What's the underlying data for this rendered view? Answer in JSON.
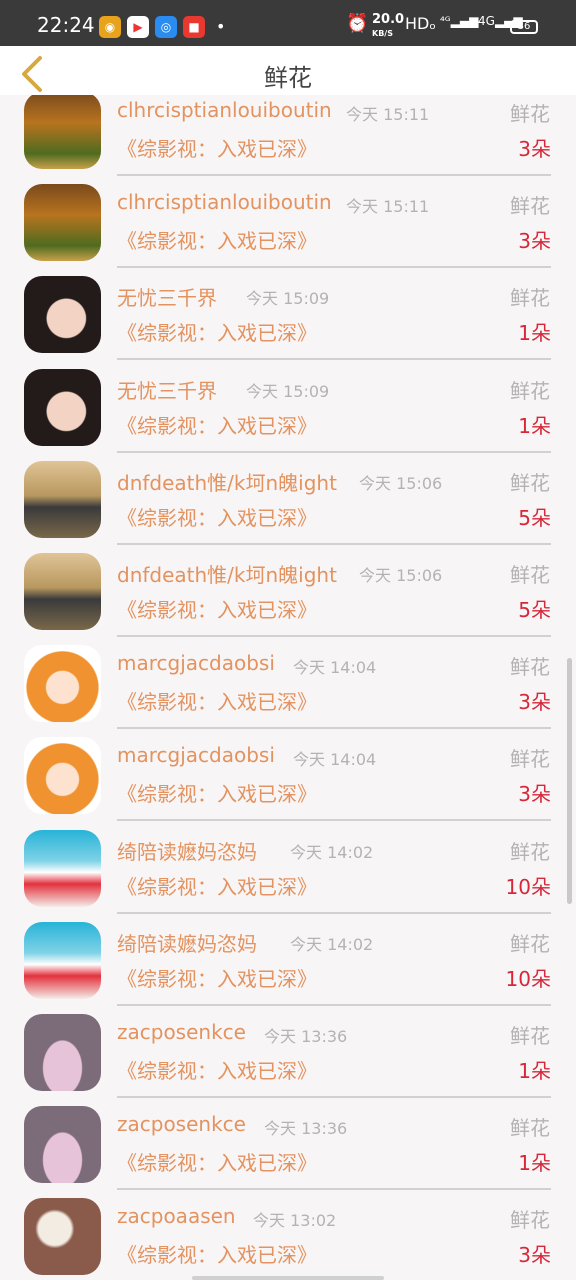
{
  "status_bar": {
    "time": "22:24",
    "speed": "20.0",
    "speed_unit": "KB/S",
    "hd": "HDₒ",
    "net1": "⁴ᴳ",
    "net2": "4G",
    "battery": "36",
    "dot": "•"
  },
  "header": {
    "title": "鲜花",
    "back_icon": "chevron-left-icon"
  },
  "items": [
    {
      "name": "clhrcisptianlouiboutin",
      "time": "今天 15:11",
      "gift": "鲜花",
      "work": "《综影视：入戏已深》",
      "count": "3朵"
    },
    {
      "name": "clhrcisptianlouiboutin",
      "time": "今天 15:11",
      "gift": "鲜花",
      "work": "《综影视：入戏已深》",
      "count": "3朵"
    },
    {
      "name": "无忧三千界",
      "time": "今天 15:09",
      "gift": "鲜花",
      "work": "《综影视：入戏已深》",
      "count": "1朵"
    },
    {
      "name": "无忧三千界",
      "time": "今天 15:09",
      "gift": "鲜花",
      "work": "《综影视：入戏已深》",
      "count": "1朵"
    },
    {
      "name": "dnfdeath惟/k坷n魄ight",
      "time": "今天 15:06",
      "gift": "鲜花",
      "work": "《综影视：入戏已深》",
      "count": "5朵"
    },
    {
      "name": "dnfdeath惟/k坷n魄ight",
      "time": "今天 15:06",
      "gift": "鲜花",
      "work": "《综影视：入戏已深》",
      "count": "5朵"
    },
    {
      "name": "marcgjacdaobsi",
      "time": "今天 14:04",
      "gift": "鲜花",
      "work": "《综影视：入戏已深》",
      "count": "3朵"
    },
    {
      "name": "marcgjacdaobsi",
      "time": "今天 14:04",
      "gift": "鲜花",
      "work": "《综影视：入戏已深》",
      "count": "3朵"
    },
    {
      "name": "绮陪读嬷妈恣妈",
      "time": "今天 14:02",
      "gift": "鲜花",
      "work": "《综影视：入戏已深》",
      "count": "10朵"
    },
    {
      "name": "绮陪读嬷妈恣妈",
      "time": "今天 14:02",
      "gift": "鲜花",
      "work": "《综影视：入戏已深》",
      "count": "10朵"
    },
    {
      "name": "zacposenkce",
      "time": "今天 13:36",
      "gift": "鲜花",
      "work": "《综影视：入戏已深》",
      "count": "1朵"
    },
    {
      "name": "zacposenkce",
      "time": "今天 13:36",
      "gift": "鲜花",
      "work": "《综影视：入戏已深》",
      "count": "1朵"
    },
    {
      "name": "zacpoaasen",
      "time": "今天 13:02",
      "gift": "鲜花",
      "work": "《综影视：入戏已深》",
      "count": "3朵"
    }
  ],
  "colors": {
    "name": "#e3935f",
    "count": "#d6283a",
    "muted": "#b3b3b3",
    "statusbar": "#3a3a3a"
  }
}
